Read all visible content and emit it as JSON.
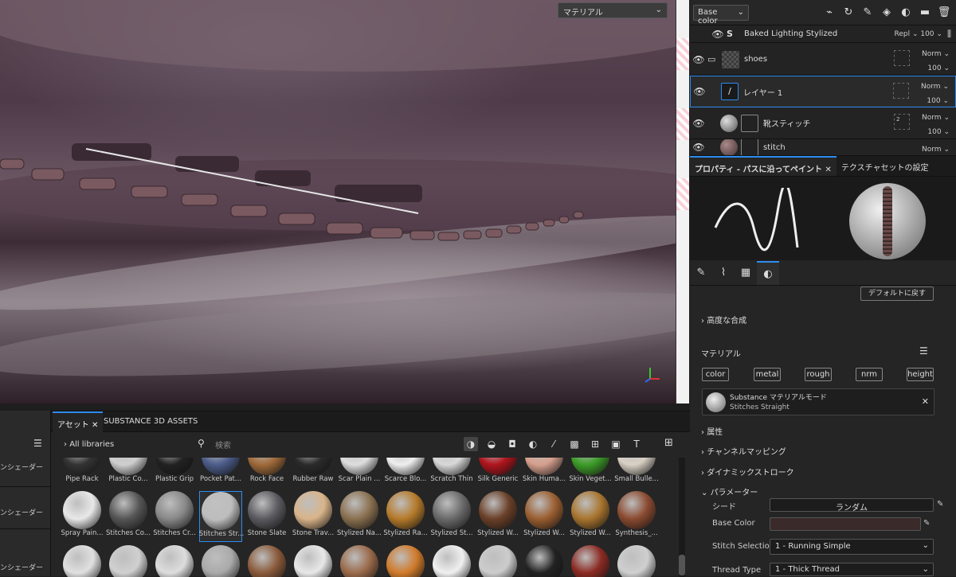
{
  "viewport": {
    "dropdown": "マテリアル"
  },
  "layers": {
    "channel": "Base color",
    "tools": [
      "brush-icon",
      "smudge-icon",
      "pen-icon",
      "fill-icon",
      "mask-icon",
      "folder-icon",
      "delete-icon"
    ],
    "rows": [
      {
        "name": "Baked Lighting Stylized",
        "blend": "Repl",
        "opacity": "100"
      },
      {
        "name": "shoes",
        "blend": "Norm",
        "opacity": "100"
      },
      {
        "name": "レイヤー 1",
        "blend": "Norm",
        "opacity": "100"
      },
      {
        "name": "靴スティッチ",
        "blend": "Norm",
        "opacity": "100",
        "mask_count": "2"
      },
      {
        "name": "stitch",
        "blend": "Norm",
        "opacity": ""
      }
    ]
  },
  "properties": {
    "tabs": [
      "プロパティ - パスに沿ってペイント",
      "テクスチャセットの設定"
    ],
    "reset": "デフォルトに戻す",
    "advanced": "高度な合成",
    "material_title": "マテリアル",
    "channels": [
      "color",
      "metal",
      "rough",
      "nrm",
      "height"
    ],
    "mat_mode": "Substance マテリアルモード",
    "mat_name": "Stitches Straight",
    "sections": [
      "属性",
      "チャンネルマッピング",
      "ダイナミックストローク",
      "パラメーター"
    ],
    "params": [
      {
        "label": "シード",
        "value": "ランダム"
      },
      {
        "label": "Base Color",
        "value": ""
      },
      {
        "label": "Stitch Selection",
        "value": "1 - Running Simple"
      },
      {
        "label": "Thread Type",
        "value": "1 - Thick Thread"
      }
    ]
  },
  "assets": {
    "tabs": [
      "アセット",
      "SUBSTANCE 3D ASSETS"
    ],
    "library": "All libraries",
    "search_placeholder": "検索",
    "left_items": [
      "ンシェーダー",
      "ンシェーダー",
      "ンシェーダー"
    ],
    "row1": [
      "Pipe Rack",
      "Plastic Co...",
      "Plastic Grip",
      "Pocket Pat...",
      "Rock Face",
      "Rubber Raw",
      "Scar Plain ...",
      "Scarce Blo...",
      "Scratch Thin",
      "Silk Generic",
      "Skin Huma...",
      "Skin Veget...",
      "Small Bulle..."
    ],
    "row2": [
      "Spray Pain...",
      "Stitches Co...",
      "Stitches Cr...",
      "Stitches Str...",
      "Stone Slate",
      "Stone Trav...",
      "Stylized Na...",
      "Stylized Ra...",
      "Stylized St...",
      "Stylized W...",
      "Stylized W...",
      "Stylized W...",
      "Synthesis_..."
    ],
    "colors1": [
      "#333",
      "#cfcfcf",
      "#222",
      "#4c5c8a",
      "#a06a3a",
      "#2b2b2b",
      "#ddd",
      "#eee",
      "#d8d8d8",
      "#b0141c",
      "#d6a08e",
      "#3c9c28",
      "#d8d0c4"
    ],
    "colors2": [
      "#e8e8e8",
      "#555",
      "#888",
      "#bdbdbd",
      "#5a5a60",
      "#d9b48a",
      "#8a7050",
      "#b57a2a",
      "#6a6a6a",
      "#6a4028",
      "#9a5e30",
      "#a8742e",
      "#8a4a30"
    ],
    "colors3": [
      "#e0e0e0",
      "#d0d0d0",
      "#ddd",
      "#aaa",
      "#8a5a3a",
      "#e8e8e8",
      "#9a6a4a",
      "#d07a2a",
      "#f0f0f0",
      "#ccc",
      "#222",
      "#8a2a22",
      "#cfcfcf"
    ]
  }
}
